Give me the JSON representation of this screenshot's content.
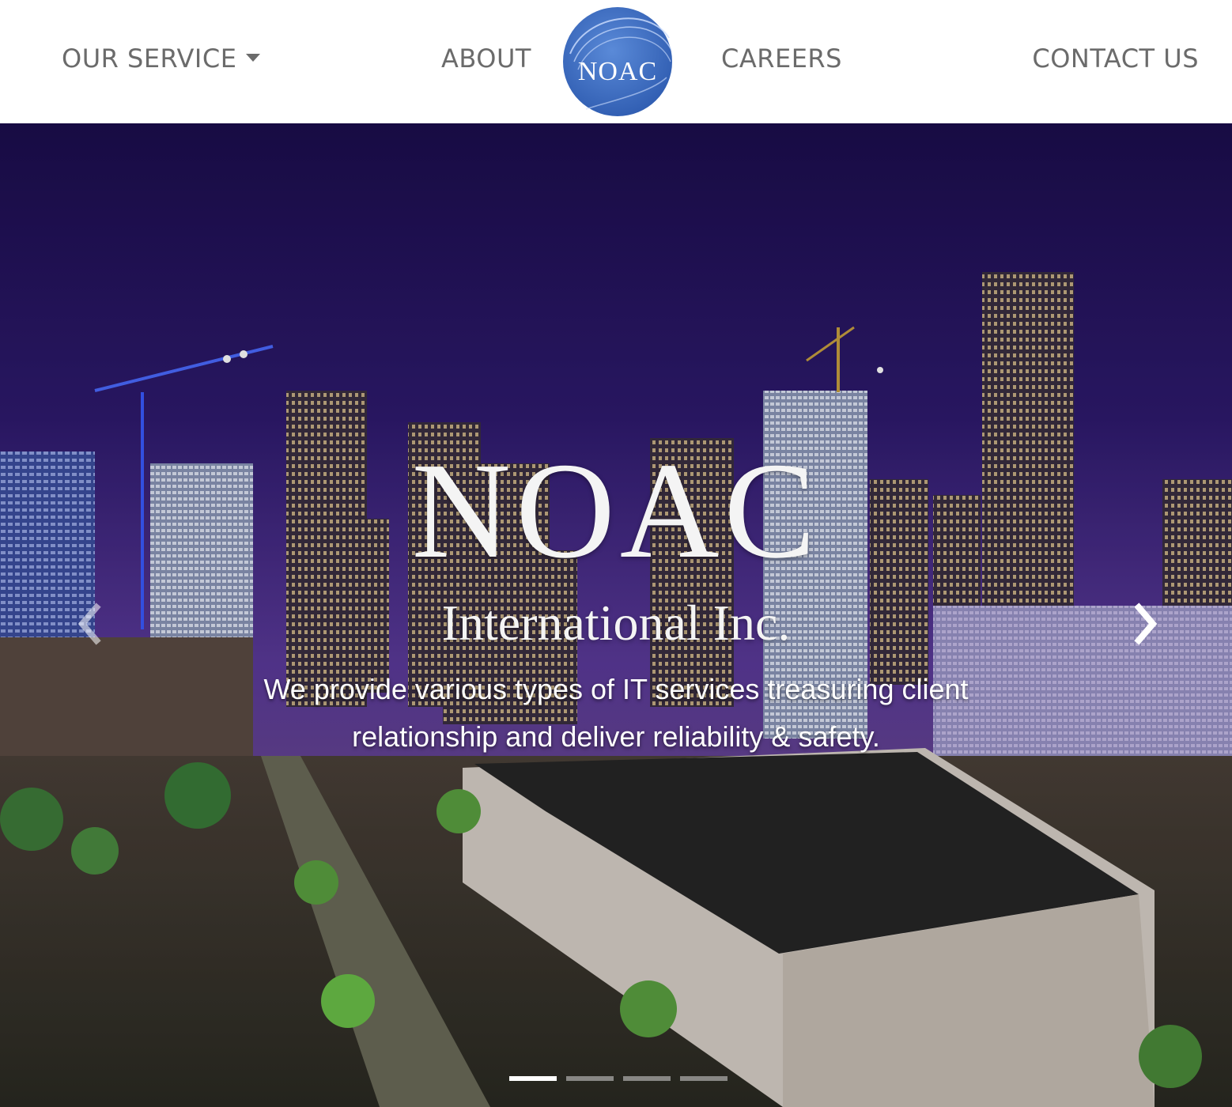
{
  "nav": {
    "service": "OUR SERVICE",
    "about": "ABOUT",
    "careers": "CAREERS",
    "contact": "CONTACT US",
    "logo_text": "NOAC"
  },
  "hero": {
    "title": "NOAC",
    "subtitle": "International Inc.",
    "description": "We provide various types of IT services treasuring client relationship and deliver reliability & safety.",
    "slides_count": 4,
    "active_slide": 1
  },
  "colors": {
    "nav_text": "#6b6b6b",
    "logo_blue": "#3a6bc0",
    "sky_top": "#1d0f52",
    "sky_mid": "#4a2e8c"
  },
  "icons": [
    "caret-down-icon",
    "chevron-left-icon",
    "chevron-right-icon"
  ]
}
